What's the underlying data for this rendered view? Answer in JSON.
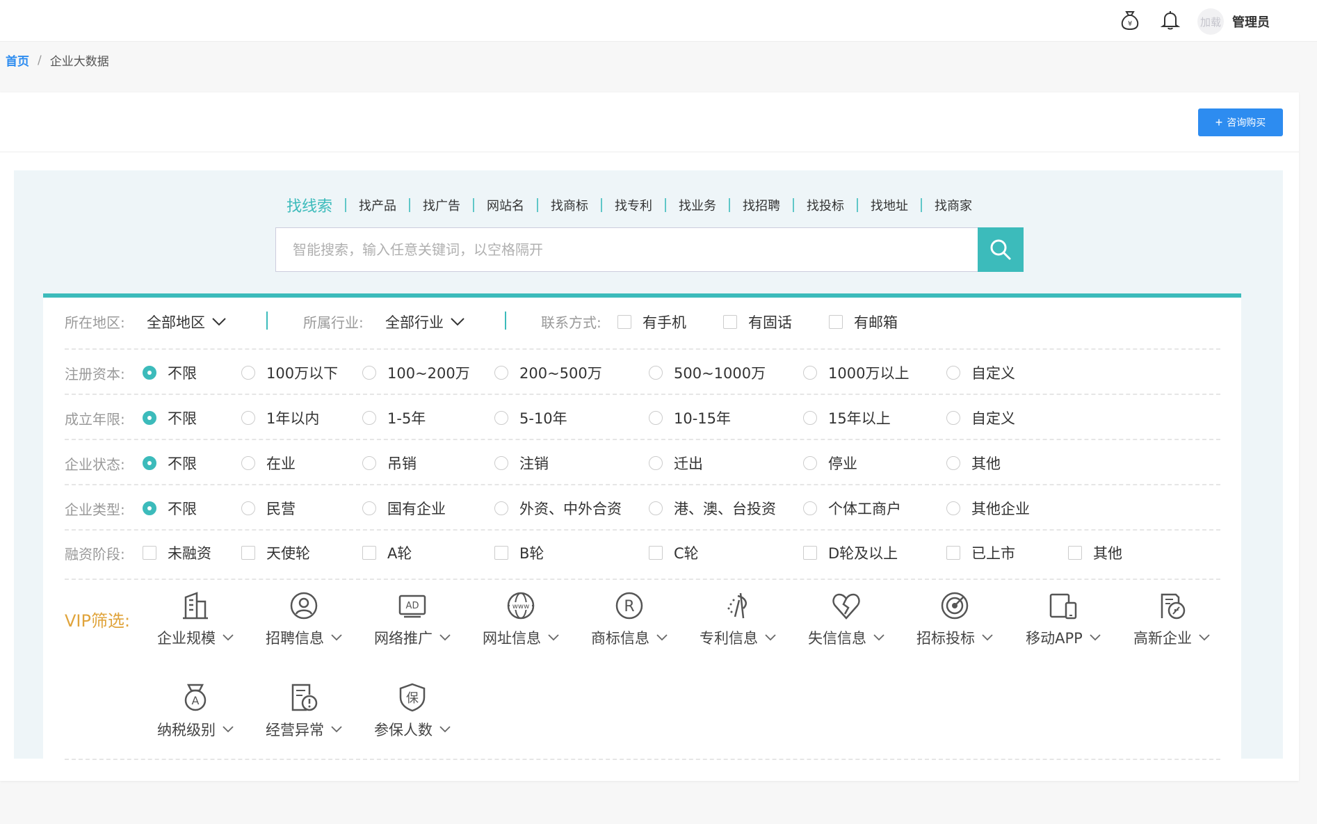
{
  "topbar": {
    "avatar_text": "加载",
    "user": "管理员"
  },
  "breadcrumb": {
    "home": "首页",
    "separator": "/",
    "current": "企业大数据"
  },
  "card": {
    "buy_button": "咨询购买"
  },
  "search": {
    "tabs": [
      "找线索",
      "找产品",
      "找广告",
      "网站名",
      "找商标",
      "找专利",
      "找业务",
      "找招聘",
      "找投标",
      "找地址",
      "找商家"
    ],
    "placeholder": "智能搜索，输入任意关键词，以空格隔开"
  },
  "filters": {
    "row1": {
      "region_label": "所在地区:",
      "region_value": "全部地区",
      "industry_label": "所属行业:",
      "industry_value": "全部行业",
      "contact_label": "联系方式:",
      "contact_options": [
        "有手机",
        "有固话",
        "有邮箱"
      ]
    },
    "capital": {
      "label": "注册资本:",
      "options": [
        "不限",
        "100万以下",
        "100~200万",
        "200~500万",
        "500~1000万",
        "1000万以上",
        "自定义"
      ]
    },
    "years": {
      "label": "成立年限:",
      "options": [
        "不限",
        "1年以内",
        "1-5年",
        "5-10年",
        "10-15年",
        "15年以上",
        "自定义"
      ]
    },
    "status": {
      "label": "企业状态:",
      "options": [
        "不限",
        "在业",
        "吊销",
        "注销",
        "迁出",
        "停业",
        "其他"
      ]
    },
    "type": {
      "label": "企业类型:",
      "options": [
        "不限",
        "民营",
        "国有企业",
        "外资、中外合资",
        "港、澳、台投资",
        "个体工商户",
        "其他企业"
      ]
    },
    "funding": {
      "label": "融资阶段:",
      "options": [
        "未融资",
        "天使轮",
        "A轮",
        "B轮",
        "C轮",
        "D轮及以上",
        "已上市",
        "其他"
      ]
    },
    "vip_label": "VIP筛选:",
    "vip_items": [
      {
        "label": "企业规模",
        "icon": "building-icon"
      },
      {
        "label": "招聘信息",
        "icon": "person-search-icon"
      },
      {
        "label": "网络推广",
        "icon": "ad-icon",
        "icon_text": "AD"
      },
      {
        "label": "网址信息",
        "icon": "www-globe-icon",
        "icon_text": "www"
      },
      {
        "label": "商标信息",
        "icon": "registered-icon",
        "icon_text": "R"
      },
      {
        "label": "专利信息",
        "icon": "patent-icon"
      },
      {
        "label": "失信信息",
        "icon": "broken-heart-icon"
      },
      {
        "label": "招标投标",
        "icon": "target-icon"
      },
      {
        "label": "移动APP",
        "icon": "devices-icon"
      },
      {
        "label": "高新企业",
        "icon": "hightech-icon"
      },
      {
        "label": "纳税级别",
        "icon": "medal-icon",
        "icon_text": "A"
      },
      {
        "label": "经营异常",
        "icon": "doc-alert-icon"
      },
      {
        "label": "参保人数",
        "icon": "shield-icon",
        "icon_text": "保"
      }
    ]
  },
  "colors": {
    "accent": "#3cbbbb",
    "primary": "#2d8cf0",
    "vip": "#e0a43c"
  }
}
